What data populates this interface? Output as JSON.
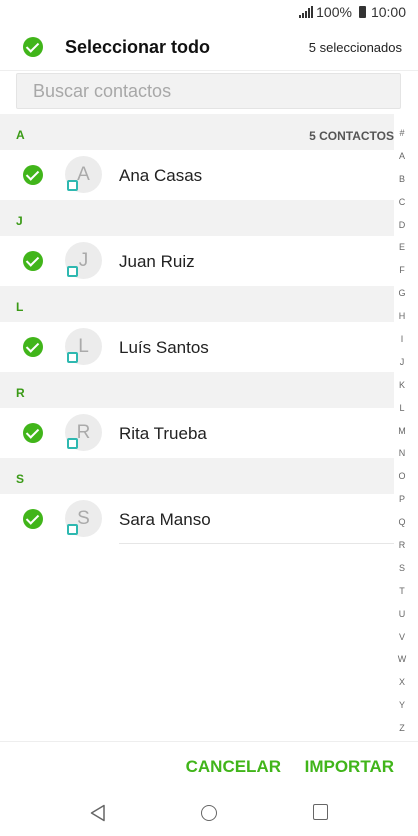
{
  "status_bar": {
    "battery": "100%",
    "time": "10:00"
  },
  "header": {
    "select_all_label": "Seleccionar todo",
    "selected_count": "5 seleccionados"
  },
  "search": {
    "placeholder": "Buscar contactos"
  },
  "sections": [
    {
      "letter": "A",
      "count_label": "5 CONTACTOS",
      "contacts": [
        {
          "initial": "A",
          "name": "Ana Casas",
          "checked": true
        }
      ]
    },
    {
      "letter": "J",
      "count_label": "",
      "contacts": [
        {
          "initial": "J",
          "name": "Juan Ruiz",
          "checked": true
        }
      ]
    },
    {
      "letter": "L",
      "count_label": "",
      "contacts": [
        {
          "initial": "L",
          "name": "Luís Santos",
          "checked": true
        }
      ]
    },
    {
      "letter": "R",
      "count_label": "",
      "contacts": [
        {
          "initial": "R",
          "name": "Rita Trueba",
          "checked": true
        }
      ]
    },
    {
      "letter": "S",
      "count_label": "",
      "contacts": [
        {
          "initial": "S",
          "name": "Sara Manso",
          "checked": true
        }
      ]
    }
  ],
  "index_letters": [
    "#",
    "A",
    "B",
    "C",
    "D",
    "E",
    "F",
    "G",
    "H",
    "I",
    "J",
    "K",
    "L",
    "M",
    "N",
    "O",
    "P",
    "Q",
    "R",
    "S",
    "T",
    "U",
    "V",
    "W",
    "X",
    "Y",
    "Z"
  ],
  "footer": {
    "cancel_label": "CANCELAR",
    "import_label": "IMPORTAR"
  },
  "icons": {
    "check": "check-circle-icon",
    "sim": "sim-card-icon",
    "back": "back-triangle-icon",
    "home": "home-circle-icon",
    "recent": "recent-square-icon"
  },
  "colors": {
    "accent": "#41b51a",
    "section_letter": "#3a9a16",
    "sim": "#2eb8b0"
  }
}
